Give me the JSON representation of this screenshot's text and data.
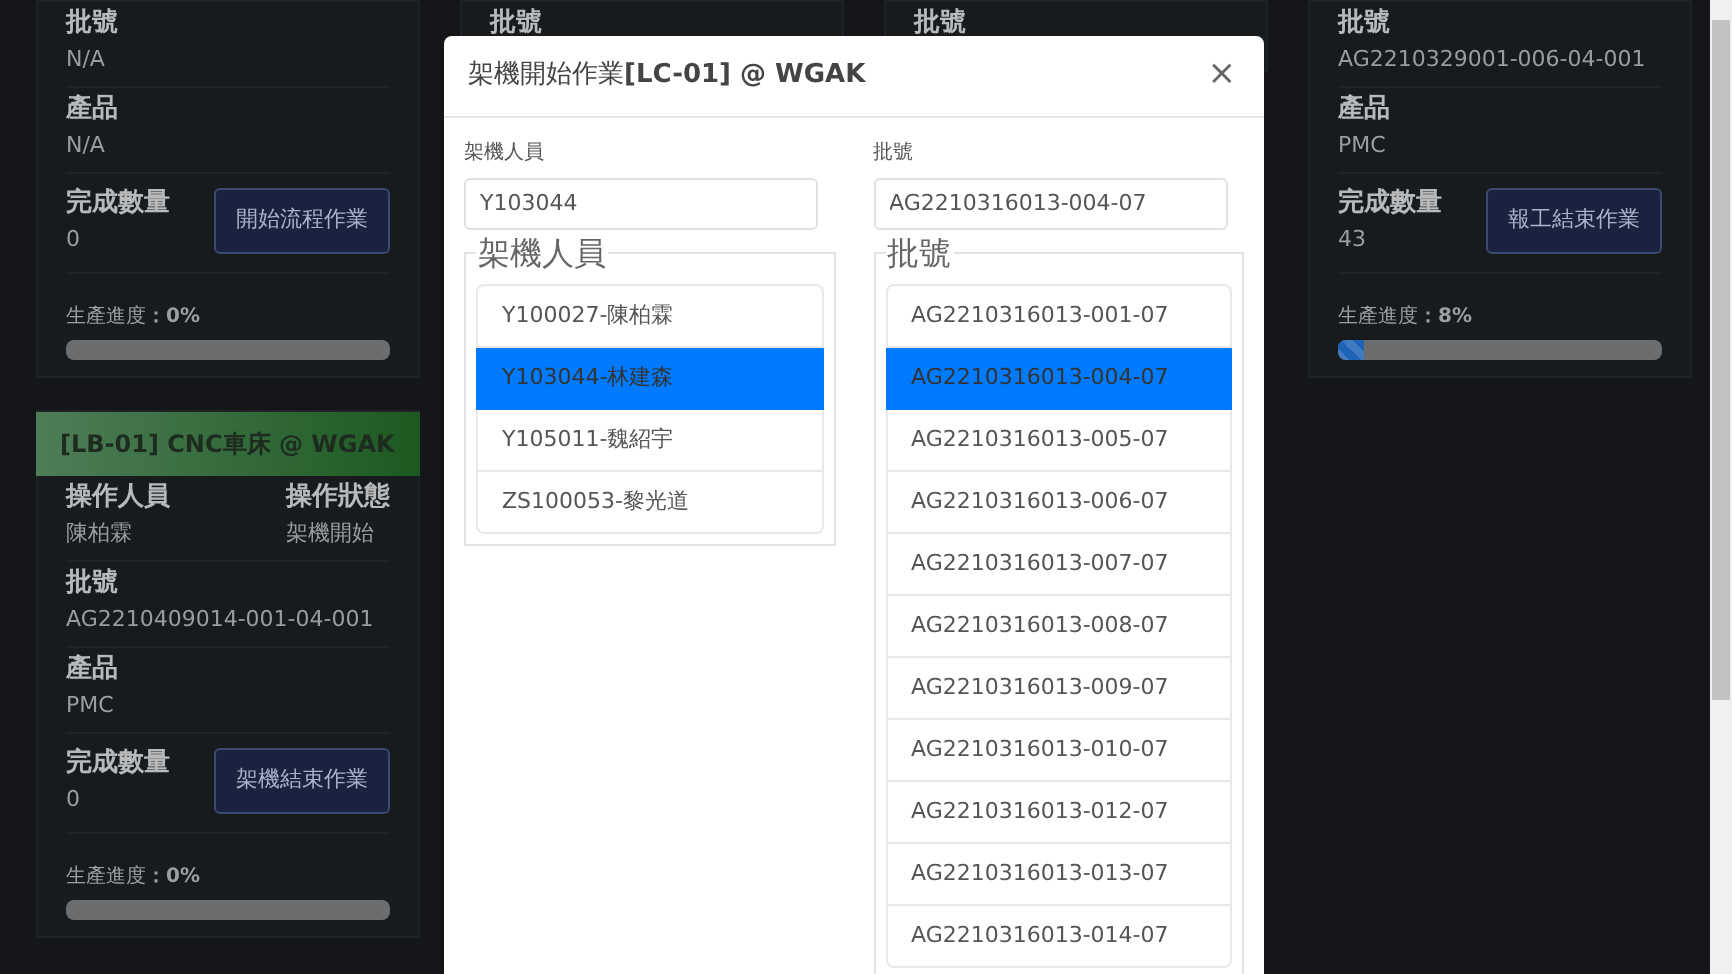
{
  "background_columns": [
    {
      "cards": [
        {
          "rows": [
            [
              {
                "label": "批號",
                "value": "N/A"
              }
            ],
            [
              {
                "label": "產品",
                "value": "N/A"
              }
            ]
          ],
          "quantity": {
            "label": "完成數量",
            "value": "0"
          },
          "button": "開始流程作業",
          "progress": {
            "text": "生產進度**：0%**",
            "level": 0
          }
        },
        {
          "header": "[LB-01] CNC車床 @ WGAK",
          "rows": [
            [
              {
                "label": "操作人員",
                "value": "陳柏霖"
              },
              {
                "label": "操作狀態",
                "value": "架機開始"
              }
            ],
            [
              {
                "label": "批號",
                "value": "AG2210409014-001-04-001"
              }
            ],
            [
              {
                "label": "產品",
                "value": "PMC"
              }
            ]
          ],
          "quantity": {
            "label": "完成數量",
            "value": "0"
          },
          "button": "架機結束作業",
          "progress": {
            "text": "生產進度**：0%**",
            "level": 0
          }
        }
      ]
    },
    {
      "cards": [
        {
          "rows": [
            [
              {
                "label": "批號"
              }
            ]
          ]
        }
      ]
    },
    {
      "cards": [
        {
          "rows": [
            [
              {
                "label": "批號"
              }
            ]
          ]
        }
      ]
    },
    {
      "cards": [
        {
          "rows": [
            [
              {
                "label": "批號",
                "value": "AG2210329001-006-04-001"
              }
            ],
            [
              {
                "label": "產品",
                "value": "PMC"
              }
            ]
          ],
          "quantity": {
            "label": "完成數量",
            "value": "43"
          },
          "button": "報工結束作業",
          "progress": {
            "text": "生產進度**：8%**",
            "level": 0.08
          }
        }
      ]
    }
  ],
  "modal": {
    "title": "架機開始作業**[LC-01] @ WGAK**",
    "close": "×",
    "panels": [
      {
        "label": "架機人員",
        "value": "Y103044",
        "legend": "架機人員",
        "items": [
          {
            "text": "Y100027-陳柏霖",
            "selected": false
          },
          {
            "text": "Y103044-林建森",
            "selected": true
          },
          {
            "text": "Y105011-魏紹宇",
            "selected": false
          },
          {
            "text": "ZS100053-黎光道",
            "selected": false
          }
        ]
      },
      {
        "label": "批號",
        "value": "AG2210316013-004-07",
        "legend": "批號",
        "items": [
          {
            "text": "AG2210316013-001-07",
            "selected": false
          },
          {
            "text": "AG2210316013-004-07",
            "selected": true
          },
          {
            "text": "AG2210316013-005-07",
            "selected": false
          },
          {
            "text": "AG2210316013-006-07",
            "selected": false
          },
          {
            "text": "AG2210316013-007-07",
            "selected": false
          },
          {
            "text": "AG2210316013-008-07",
            "selected": false
          },
          {
            "text": "AG2210316013-009-07",
            "selected": false
          },
          {
            "text": "AG2210316013-010-07",
            "selected": false
          },
          {
            "text": "AG2210316013-012-07",
            "selected": false
          },
          {
            "text": "AG2210316013-013-07",
            "selected": false
          },
          {
            "text": "AG2210316013-014-07",
            "selected": false
          }
        ]
      }
    ]
  }
}
